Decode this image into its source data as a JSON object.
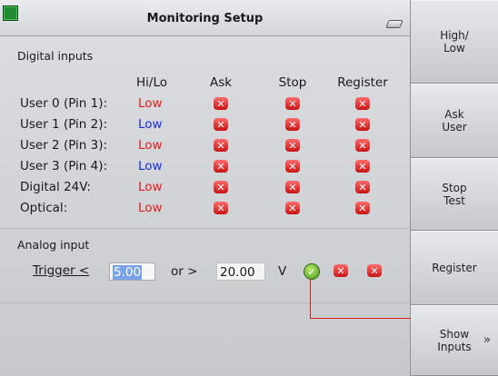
{
  "window": {
    "title": "Monitoring Setup"
  },
  "digital_inputs": {
    "section_label": "Digital inputs",
    "columns": [
      "Hi/Lo",
      "Ask",
      "Stop",
      "Register"
    ],
    "rows": [
      {
        "label": "User 0 (Pin 1):",
        "value": "Low",
        "value_color": "red"
      },
      {
        "label": "User 1 (Pin 2):",
        "value": "Low",
        "value_color": "blue"
      },
      {
        "label": "User 2 (Pin 3):",
        "value": "Low",
        "value_color": "red"
      },
      {
        "label": "User 3 (Pin 4):",
        "value": "Low",
        "value_color": "blue"
      },
      {
        "label": "Digital 24V:",
        "value": "Low",
        "value_color": "red"
      },
      {
        "label": "Optical:",
        "value": "Low",
        "value_color": "red"
      }
    ]
  },
  "analog_input": {
    "section_label": "Analog input",
    "trigger_label": "Trigger <",
    "low_value": "5.00",
    "or_text": "or >",
    "high_value": "20.00",
    "unit": "V"
  },
  "sidebar": {
    "buttons": [
      {
        "label": "High/\nLow"
      },
      {
        "label": "Ask\nUser"
      },
      {
        "label": "Stop\nTest"
      },
      {
        "label": "Register"
      },
      {
        "label": "Show\nInputs",
        "chevron": "»"
      }
    ]
  },
  "colors": {
    "accent_red": "#e21c1c",
    "accent_blue": "#1a2ee8",
    "connector_line": "#e01818"
  }
}
